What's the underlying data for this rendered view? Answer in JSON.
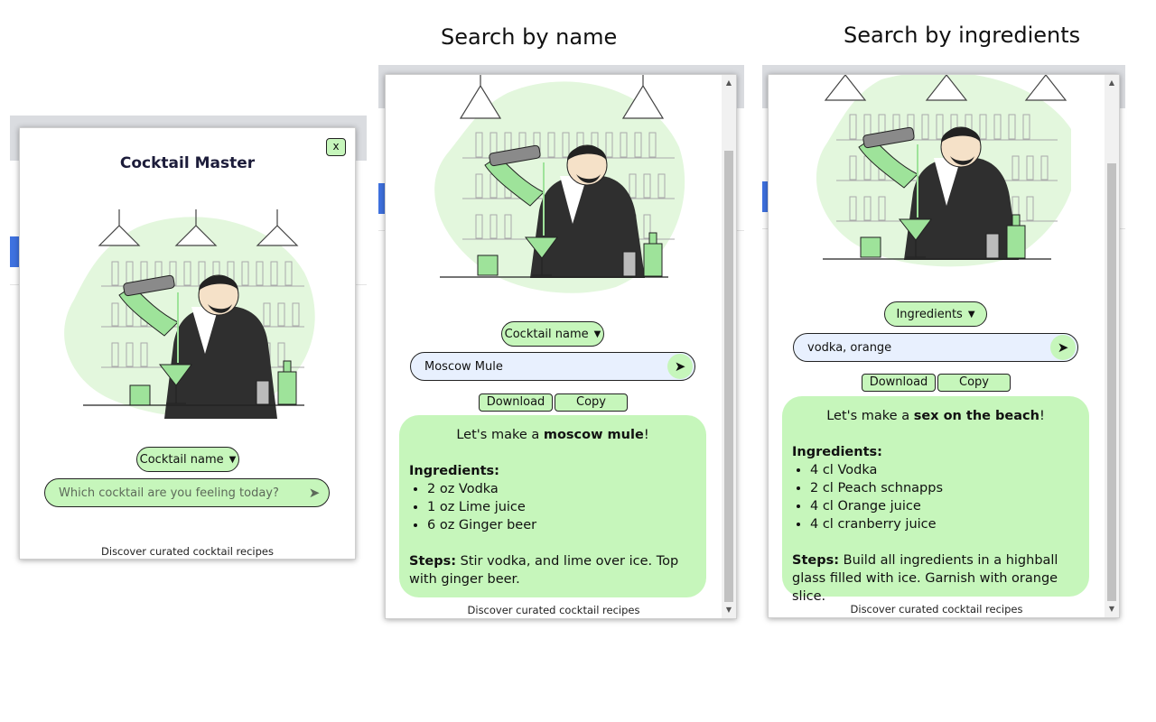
{
  "captions": {
    "by_name": "Search by name",
    "by_ingredients": "Search by ingredients"
  },
  "colors": {
    "accent_green": "#c6f6bb",
    "search_filled": "#e8f0fe",
    "title": "#1c1c3a"
  },
  "popup1": {
    "title": "Cocktail Master",
    "close_label": "x",
    "mode_select": "Cocktail name",
    "search_placeholder": "Which cocktail are you feeling today?",
    "footer": "Discover curated cocktail recipes"
  },
  "popup2": {
    "mode_select": "Cocktail name",
    "search_value": "Moscow Mule",
    "download_label": "Download",
    "copy_label": "Copy",
    "result": {
      "intro_prefix": "Let's make a ",
      "drink": "moscow mule",
      "intro_suffix": "!",
      "ingredients_label": "Ingredients:",
      "ingredients": [
        "2 oz Vodka",
        "1 oz Lime juice",
        "6 oz Ginger beer"
      ],
      "steps_label": "Steps:",
      "steps": " Stir vodka, and lime over ice. Top with ginger beer."
    },
    "footer": "Discover curated cocktail recipes"
  },
  "popup3": {
    "mode_select": "Ingredients",
    "search_value": "vodka, orange",
    "download_label": "Download",
    "copy_label": "Copy",
    "result": {
      "intro_prefix": "Let's make a ",
      "drink": "sex on the beach",
      "intro_suffix": "!",
      "ingredients_label": "Ingredients:",
      "ingredients": [
        "4 cl Vodka",
        "2 cl Peach schnapps",
        "4 cl Orange juice",
        "4 cl cranberry juice"
      ],
      "steps_label": "Steps:",
      "steps": " Build all ingredients in a highball glass filled with ice. Garnish with orange slice."
    },
    "footer": "Discover curated cocktail recipes"
  },
  "icons": {
    "send": "send-arrow-icon",
    "chevron": "chevron-down-icon"
  }
}
